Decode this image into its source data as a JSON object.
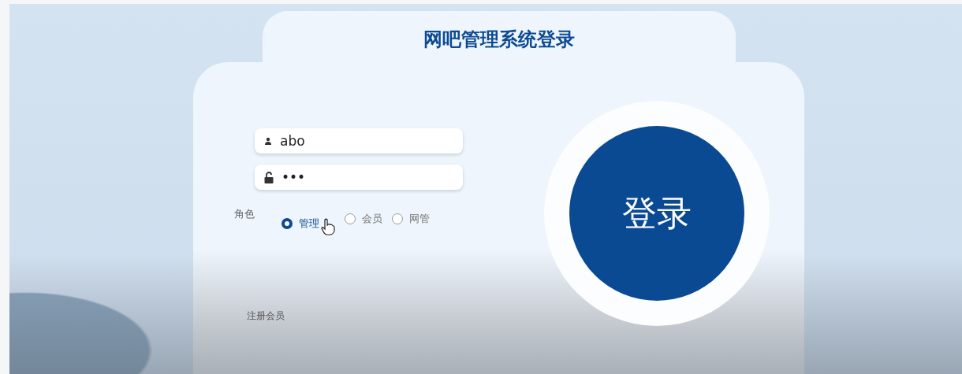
{
  "title": "网吧管理系统登录",
  "username": {
    "value": "abo"
  },
  "password": {
    "value": "•••"
  },
  "role": {
    "label": "角色",
    "options": [
      {
        "label": "管理",
        "selected": true
      },
      {
        "label": "会员",
        "selected": false
      },
      {
        "label": "网管",
        "selected": false
      }
    ]
  },
  "login_button": "登录",
  "register_link": "注册会员"
}
